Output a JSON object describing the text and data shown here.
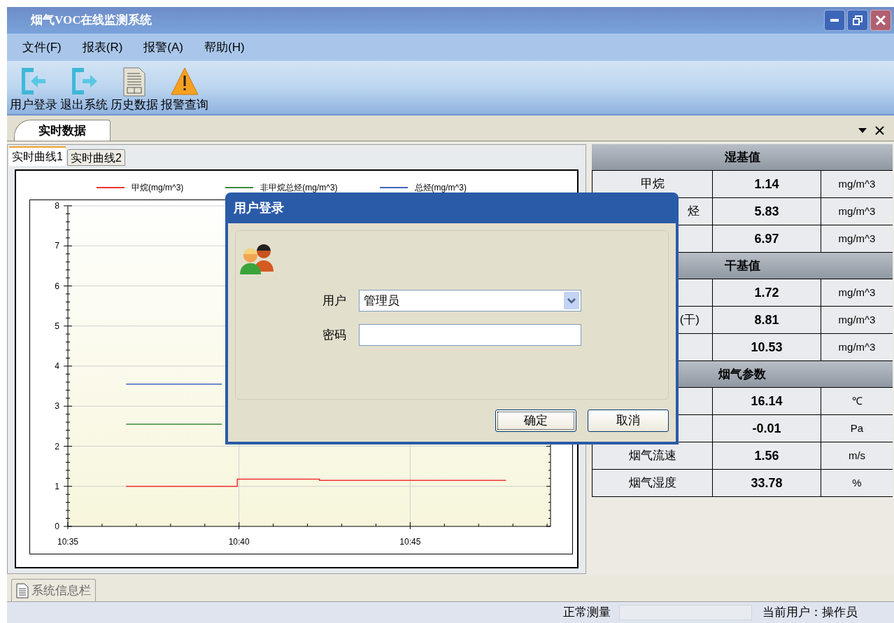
{
  "window": {
    "title": "烟气VOC在线监测系统"
  },
  "menu": [
    "文件(F)",
    "报表(R)",
    "报警(A)",
    "帮助(H)"
  ],
  "toolbar": [
    {
      "label": "用户登录",
      "kind": "login"
    },
    {
      "label": "退出系统",
      "kind": "exit"
    },
    {
      "label": "历史数据",
      "kind": "document"
    },
    {
      "label": "报警查询",
      "kind": "warning"
    }
  ],
  "document_tabs": [
    {
      "label": "实时数据",
      "selected": true
    }
  ],
  "chart_tabs": [
    {
      "label": "实时曲线1",
      "selected": true
    },
    {
      "label": "实时曲线2",
      "selected": false
    }
  ],
  "chart": {
    "chart_data": {
      "type": "line",
      "grid": true,
      "x": [
        636.7,
        639.5,
        639.9,
        639.95,
        642.3,
        642.35,
        647.8
      ],
      "xlim": [
        635,
        649.1
      ],
      "ylim": [
        0,
        8
      ],
      "xticks": [
        {
          "value": 635,
          "label": "10:35"
        },
        {
          "value": 640,
          "label": "10:40"
        },
        {
          "value": 645,
          "label": "10:45"
        }
      ],
      "yticks": [
        0,
        1,
        2,
        3,
        4,
        5,
        6,
        7,
        8
      ],
      "series": [
        {
          "name": "甲烷(mg/m^3)",
          "color": "#ee3333",
          "values": [
            1.0,
            1.0,
            1.0,
            1.18,
            1.18,
            1.15,
            1.15
          ]
        },
        {
          "name": "非甲烷总烃(mg/m^3)",
          "color": "#3a8a3a",
          "values": [
            2.55,
            2.55,
            null,
            null,
            null,
            null,
            null
          ]
        },
        {
          "name": "总烃(mg/m^3)",
          "color": "#3b68c0",
          "values": [
            3.55,
            3.55,
            null,
            null,
            null,
            null,
            null
          ]
        }
      ]
    }
  },
  "table": {
    "sections": [
      {
        "title": "湿基值",
        "rows": [
          {
            "label": "甲烷",
            "value": "1.14",
            "unit": "mg/m^3"
          },
          {
            "label": "烃",
            "label_cut": true,
            "value": "5.83",
            "unit": "mg/m^3"
          },
          {
            "value": "6.97",
            "unit": "mg/m^3"
          }
        ]
      },
      {
        "title": "干基值",
        "rows": [
          {
            "value": "1.72",
            "unit": "mg/m^3"
          },
          {
            "label": "(干)",
            "label_cut": true,
            "value": "8.81",
            "unit": "mg/m^3"
          },
          {
            "value": "10.53",
            "unit": "mg/m^3"
          }
        ]
      },
      {
        "title": "烟气参数",
        "rows": [
          {
            "value": "16.14",
            "unit": "℃"
          },
          {
            "value": "-0.01",
            "unit": "Pa"
          },
          {
            "label": "烟气流速",
            "value": "1.56",
            "unit": "m/s"
          },
          {
            "label": "烟气湿度",
            "value": "33.78",
            "unit": "%"
          }
        ]
      }
    ]
  },
  "dialog": {
    "title": "用户登录",
    "fields": [
      {
        "label": "用户",
        "kind": "combo",
        "value": "管理员"
      },
      {
        "label": "密码",
        "kind": "password"
      }
    ],
    "buttons": [
      {
        "label": "确定",
        "focused": true
      },
      {
        "label": "取消",
        "focused": false
      }
    ]
  },
  "bottom_tabs": [
    {
      "label": "系统信息栏",
      "selected": false
    }
  ],
  "status_bar": {
    "status": "正常测量",
    "user": "当前用户：操作员"
  }
}
